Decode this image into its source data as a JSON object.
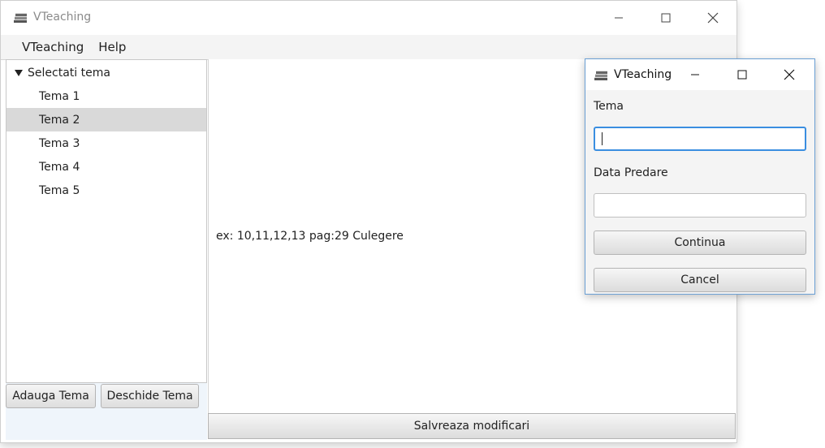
{
  "main_window": {
    "title": "VTeaching",
    "icon": "books-icon",
    "controls": [
      "minimize-icon",
      "maximize-icon",
      "close-icon"
    ]
  },
  "menubar": {
    "items": [
      "VTeaching",
      "Help"
    ]
  },
  "tree": {
    "root_label": "Selectati tema",
    "items": [
      "Tema 1",
      "Tema 2",
      "Tema 3",
      "Tema 4",
      "Tema 5"
    ],
    "selected": "Tema 2"
  },
  "left_buttons": {
    "add": "Adauga Tema",
    "open": "Deschide Tema"
  },
  "content": {
    "text": "ex: 10,11,12,13 pag:29 Culegere"
  },
  "save_button": "Salvreaza modificari",
  "dialog": {
    "title": "VTeaching",
    "icon": "books-icon",
    "tema_label": "Tema",
    "tema_value": "",
    "data_label": "Data Predare",
    "data_value": "",
    "continue_label": "Continua",
    "cancel_label": "Cancel"
  },
  "colors": {
    "selection": "#d9d9d9",
    "focus_border": "#3a8ee0",
    "dialog_border": "#6a9fd4"
  }
}
